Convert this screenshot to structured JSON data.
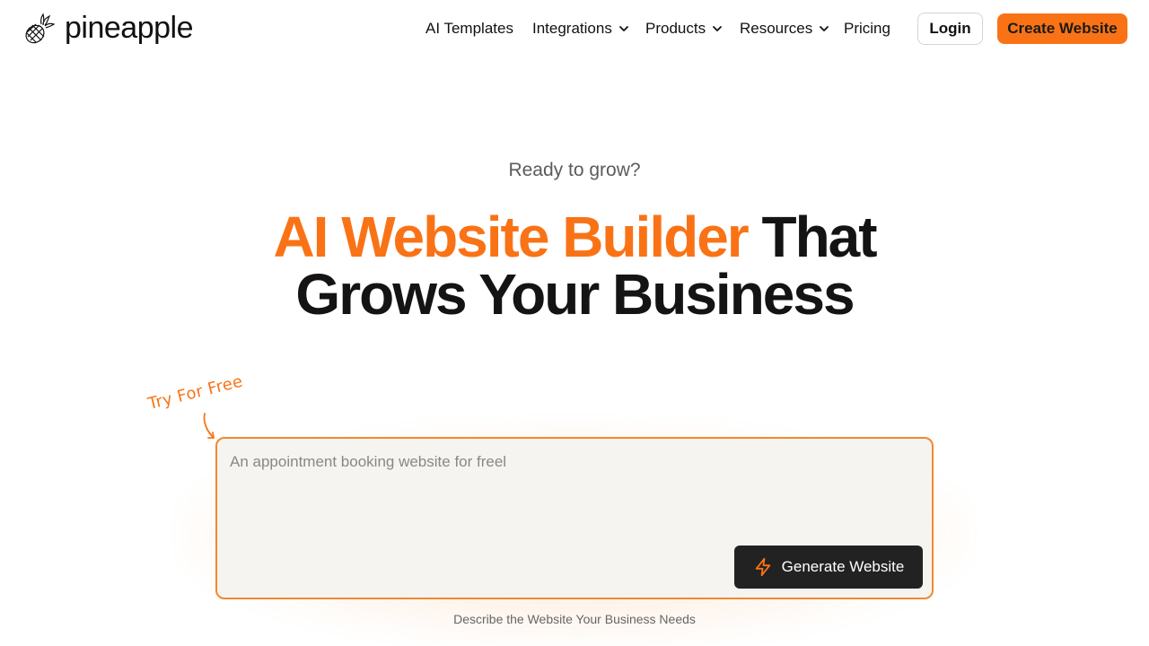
{
  "brand": {
    "name": "pineapple",
    "logo_icon": "pineapple-icon"
  },
  "nav": {
    "items": [
      {
        "label": "AI Templates",
        "dropdown": false
      },
      {
        "label": "Integrations",
        "dropdown": true
      },
      {
        "label": "Products",
        "dropdown": true
      },
      {
        "label": "Resources",
        "dropdown": true
      },
      {
        "label": "Pricing",
        "dropdown": false
      }
    ],
    "login_label": "Login",
    "create_label": "Create Website"
  },
  "hero": {
    "eyebrow": "Ready to grow?",
    "headline_accent": "AI Website Builder",
    "headline_rest_1": " That",
    "headline_line_2": "Grows Your Business"
  },
  "prompt": {
    "try_label": "Try For Free",
    "placeholder": "An appointment booking website for freel",
    "generate_label": "Generate Website",
    "generate_icon": "lightning-bolt-icon",
    "caption": "Describe the Website Your Business Needs"
  },
  "colors": {
    "accent": "#f97316",
    "dark_button": "#222222",
    "input_bg": "#f6f4f1"
  }
}
